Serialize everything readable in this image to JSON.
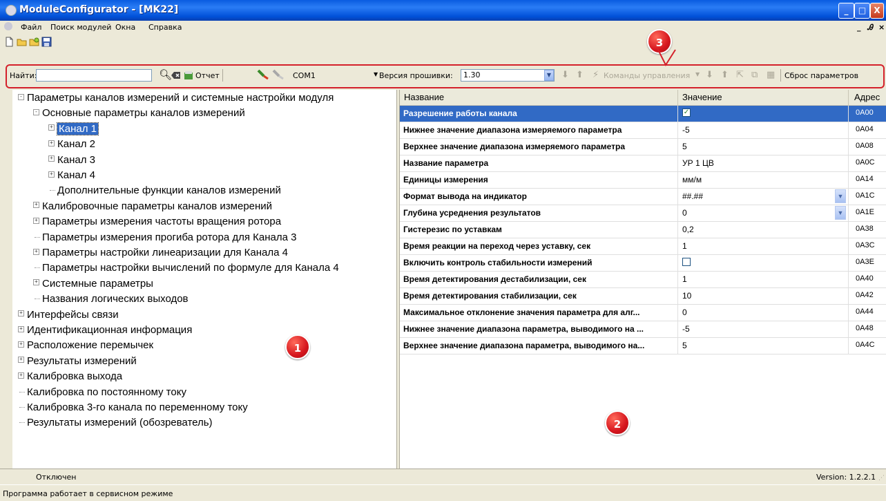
{
  "window": {
    "title": "ModuleConfigurator - [MK22]",
    "minimize": "_",
    "maximize": "□",
    "close": "X"
  },
  "menu": {
    "items": [
      "Файл",
      "Поиск модулей",
      "Окна",
      "Справка"
    ],
    "mdi_min": "_",
    "mdi_restore": "Ꭿ",
    "mdi_close": "×"
  },
  "toolbar": {
    "find_label": "Найти:",
    "find_value": "",
    "report_label": "Отчет",
    "port": "COM1",
    "firmware_label": "Версия прошивки:",
    "firmware_value": "1.30",
    "commands_label": "Команды управления",
    "reset_label": "Сброс параметров"
  },
  "badges": [
    "1",
    "2",
    "3"
  ],
  "tree": [
    {
      "label": "Параметры каналов измерений и системные настройки модуля",
      "level": 0,
      "exp": "-"
    },
    {
      "label": "Основные параметры каналов измерений",
      "level": 1,
      "exp": "-"
    },
    {
      "label": "Канал 1",
      "level": 2,
      "exp": "+",
      "selected": true
    },
    {
      "label": "Канал 2",
      "level": 2,
      "exp": "+"
    },
    {
      "label": "Канал 3",
      "level": 2,
      "exp": "+"
    },
    {
      "label": "Канал 4",
      "level": 2,
      "exp": "+"
    },
    {
      "label": "Дополнительные функции каналов измерений",
      "level": 2,
      "exp": ""
    },
    {
      "label": "Калибровочные параметры каналов измерений",
      "level": 1,
      "exp": "+"
    },
    {
      "label": "Параметры измерения частоты вращения ротора",
      "level": 1,
      "exp": "+"
    },
    {
      "label": "Параметры измерения прогиба ротора для Канала 3",
      "level": 1,
      "exp": ""
    },
    {
      "label": "Параметры настройки линеаризации для Канала 4",
      "level": 1,
      "exp": "+"
    },
    {
      "label": "Параметры настройки вычислений по формуле для Канала 4",
      "level": 1,
      "exp": ""
    },
    {
      "label": "Системные параметры",
      "level": 1,
      "exp": "+"
    },
    {
      "label": "Названия логических выходов",
      "level": 1,
      "exp": ""
    },
    {
      "label": "Интерфейсы связи",
      "level": 0,
      "exp": "+"
    },
    {
      "label": "Идентификационная информация",
      "level": 0,
      "exp": "+"
    },
    {
      "label": "Расположение перемычек",
      "level": 0,
      "exp": "+"
    },
    {
      "label": "Результаты измерений",
      "level": 0,
      "exp": "+"
    },
    {
      "label": "Калибровка выхода",
      "level": 0,
      "exp": "+"
    },
    {
      "label": "Калибровка по постоянному току",
      "level": 0,
      "exp": ""
    },
    {
      "label": "Калибровка 3-го канала по переменному току",
      "level": 0,
      "exp": ""
    },
    {
      "label": "Результаты измерений (обозреватель)",
      "level": 0,
      "exp": ""
    }
  ],
  "grid": {
    "headers": [
      "Название",
      "Значение",
      "Адрес"
    ],
    "rows": [
      {
        "name": "Разрешение работы канала",
        "type": "check",
        "checked": true,
        "value": "✓",
        "addr": "0A00",
        "selected": true
      },
      {
        "name": "Нижнее значение диапазона измеряемого параметра",
        "type": "text",
        "value": "-5",
        "addr": "0A04"
      },
      {
        "name": "Верхнее значение диапазона измеряемого параметра",
        "type": "text",
        "value": "5",
        "addr": "0A08"
      },
      {
        "name": "Название параметра",
        "type": "text",
        "value": "УР 1 ЦВ",
        "addr": "0A0C"
      },
      {
        "name": "Единицы измерения",
        "type": "text",
        "value": "мм/м",
        "addr": "0A14"
      },
      {
        "name": "Формат вывода на индикатор",
        "type": "combo",
        "value": "##.##",
        "addr": "0A1C"
      },
      {
        "name": "Глубина усреднения результатов",
        "type": "combo",
        "value": "0",
        "addr": "0A1E"
      },
      {
        "name": "Гистерезис по уставкам",
        "type": "text",
        "value": "0,2",
        "addr": "0A38"
      },
      {
        "name": "Время реакции на переход через уставку, сек",
        "type": "text",
        "value": "1",
        "addr": "0A3C"
      },
      {
        "name": "Включить контроль стабильности измерений",
        "type": "check",
        "checked": false,
        "value": "",
        "addr": "0A3E"
      },
      {
        "name": "Время детектирования дестабилизации, сек",
        "type": "text",
        "value": "1",
        "addr": "0A40"
      },
      {
        "name": "Время детектирования стабилизации, сек",
        "type": "text",
        "value": "10",
        "addr": "0A42"
      },
      {
        "name": "Максимальное отклонение значения параметра для алг...",
        "type": "text",
        "value": "0",
        "addr": "0A44"
      },
      {
        "name": "Нижнее значение диапазона параметра, выводимого на ...",
        "type": "text",
        "value": "-5",
        "addr": "0A48"
      },
      {
        "name": "Верхнее значение диапазона параметра, выводимого на...",
        "type": "text",
        "value": "5",
        "addr": "0A4C"
      }
    ]
  },
  "status": {
    "connection": "Отключен",
    "version": "Version: 1.2.2.1",
    "mode": "Программа работает в сервисном режиме"
  }
}
